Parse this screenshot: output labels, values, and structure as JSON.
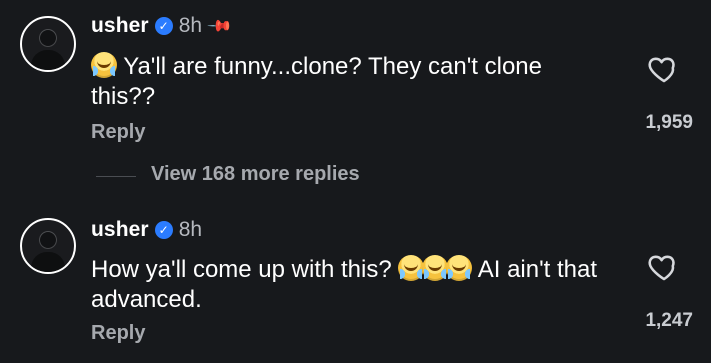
{
  "comments": [
    {
      "username": "usher",
      "time": "8h",
      "pinned": true,
      "text": "Ya'll are funny...clone?  They can't clone this??",
      "reply_label": "Reply",
      "likes": "1,959"
    },
    {
      "username": "usher",
      "time": "8h",
      "pinned": false,
      "text_before_emoji": "How ya'll come up with this?",
      "text_after_emoji": "AI ain't that advanced.",
      "reply_label": "Reply",
      "likes": "1,247"
    }
  ],
  "view_more_label": "View 168 more replies",
  "icons": {
    "verified": "verified-badge-icon",
    "pin": "pin-icon",
    "heart": "heart-icon",
    "emoji": "face-with-tears-of-joy-icon"
  },
  "colors": {
    "background": "#17191c",
    "text": "#ffffff",
    "muted": "#a6a9ae",
    "verified": "#2b7cff"
  }
}
